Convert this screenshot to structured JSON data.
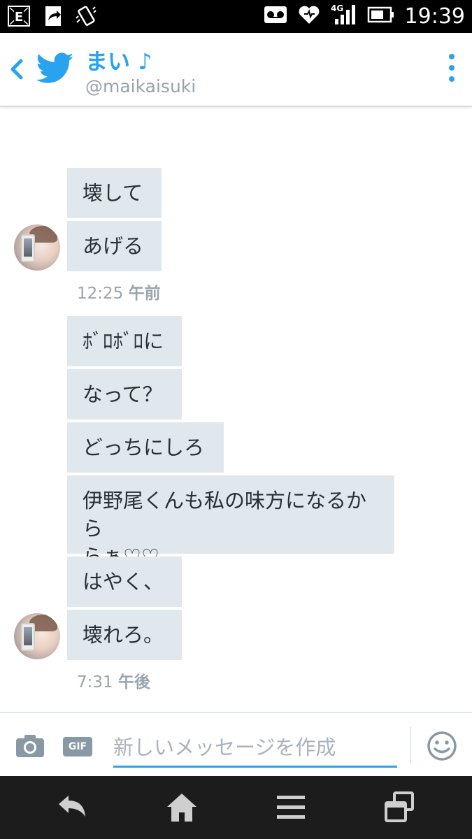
{
  "status_bar": {
    "time": "19:39",
    "network": "4G",
    "icons": [
      "e-notification-icon",
      "share-icon",
      "vibrate-icon",
      "voicemail-icon",
      "heart-icon",
      "signal-icon",
      "battery-icon"
    ]
  },
  "header": {
    "name": "まい ♪",
    "handle": "@maikaisuki",
    "accent": "#2aa3ef"
  },
  "messages": [
    {
      "text": "壊して"
    },
    {
      "text": "あげる"
    },
    {
      "text": "ﾎﾞﾛﾎﾞﾛに"
    },
    {
      "text": "なって？"
    },
    {
      "text": "どっちにしろ"
    },
    {
      "text": "伊野尾くんも私の味方になるから"
    },
    {
      "text": "らぁ♡♡"
    },
    {
      "text": "はやく、"
    },
    {
      "text": "壊れろ。"
    }
  ],
  "timestamps": [
    {
      "time": "12:25",
      "period": "午前"
    },
    {
      "time": "7:31",
      "period": "午後"
    }
  ],
  "composer": {
    "gif_label": "GIF",
    "placeholder": "新しいメッセージを作成"
  },
  "colors": {
    "bubble": "#e1e8ed",
    "text": "#292f33",
    "timestamp": "#9aa4ad"
  }
}
